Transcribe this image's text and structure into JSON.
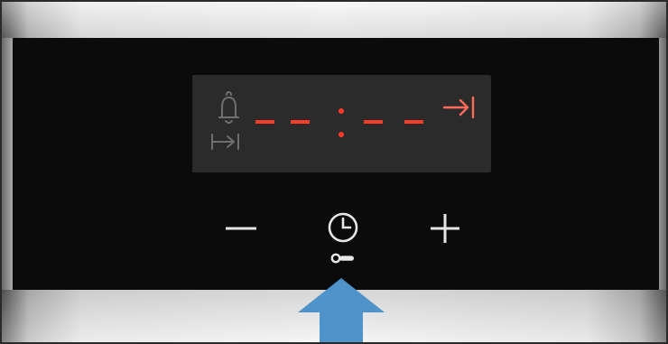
{
  "display": {
    "time_value": "--:--",
    "icons": {
      "alarm": "bell-icon",
      "duration": "duration-icon",
      "end_time": "end-time-icon"
    },
    "colors": {
      "active": "#ff3b2a",
      "inactive": "#6f6f6f",
      "screen": "#2b2b2b"
    }
  },
  "controls": {
    "minus": "minus-icon",
    "clock": "clock-icon",
    "lock": "key-icon",
    "plus": "plus-icon"
  },
  "pointer": {
    "icon": "up-arrow-icon",
    "color": "#4e93c9"
  }
}
